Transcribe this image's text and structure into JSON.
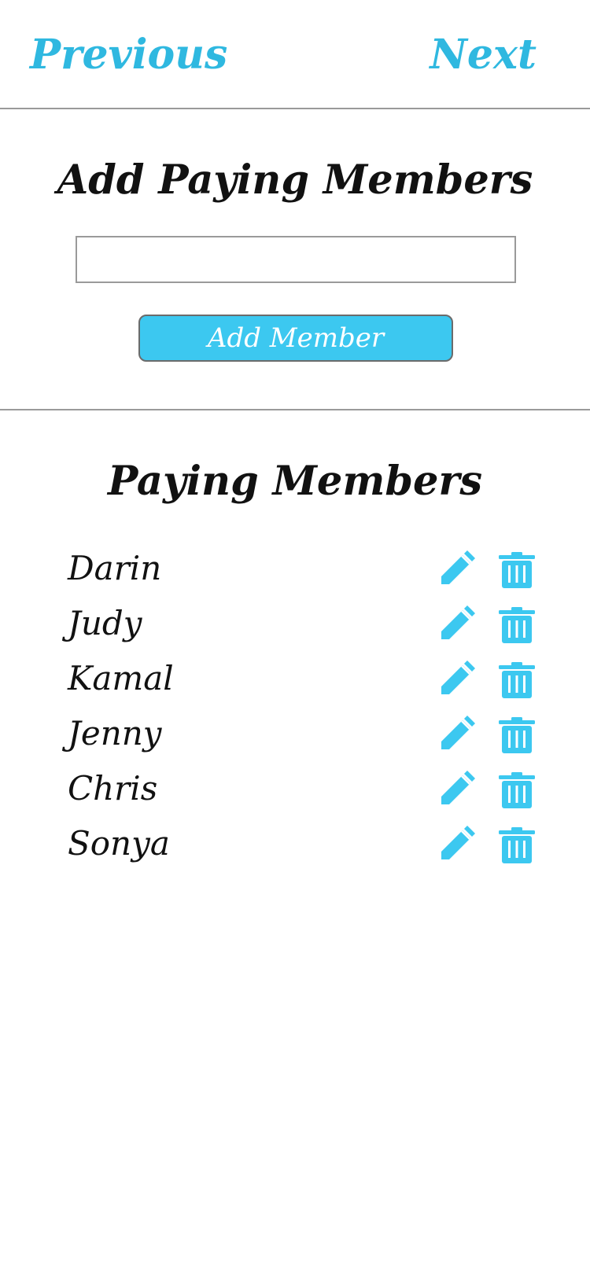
{
  "nav": {
    "previous_label": "Previous",
    "next_label": "Next"
  },
  "add_section": {
    "title": "Add Paying Members",
    "input_value": "",
    "input_placeholder": "",
    "button_label": "Add Member"
  },
  "list_section": {
    "title": "Paying Members",
    "members": [
      {
        "name": "Darin"
      },
      {
        "name": "Judy"
      },
      {
        "name": "Kamal"
      },
      {
        "name": "Jenny"
      },
      {
        "name": "Chris"
      },
      {
        "name": "Sonya"
      }
    ],
    "row_icons": [
      "pencil-icon",
      "trash-icon"
    ]
  },
  "colors": {
    "accent": "#3cc8f0",
    "link": "#2fb8e0",
    "text": "#111111",
    "divider": "#9a9a9a"
  }
}
